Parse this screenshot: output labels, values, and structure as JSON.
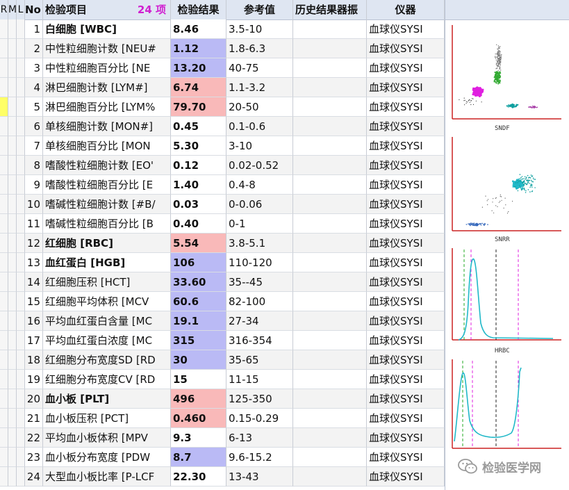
{
  "header": {
    "col_r": "R",
    "col_m": "M",
    "col_l": "L",
    "col_no": "No",
    "col_name": "检验项目",
    "item_count": "24 项",
    "col_result": "检验结果",
    "col_ref": "参考值",
    "col_history": "历史结果",
    "col_history_cut": "器振",
    "col_instrument": "仪器"
  },
  "rows": [
    {
      "no": "1",
      "name": "白细胞 [WBC]",
      "result": "8.46",
      "ref": "3.5-10",
      "instrument": "血球仪SYSI",
      "flag": "normal",
      "bold": true
    },
    {
      "no": "2",
      "name": "中性粒细胞计数 [NEU#",
      "result": "1.12",
      "ref": "1.8-6.3",
      "instrument": "血球仪SYSI",
      "flag": "low",
      "bold": false
    },
    {
      "no": "3",
      "name": "中性粒细胞百分比 [NE",
      "result": "13.20",
      "ref": "40-75",
      "instrument": "血球仪SYSI",
      "flag": "low",
      "bold": false
    },
    {
      "no": "4",
      "name": "淋巴细胞计数 [LYM#]",
      "result": "6.74",
      "ref": "1.1-3.2",
      "instrument": "血球仪SYSI",
      "flag": "high",
      "bold": false
    },
    {
      "no": "5",
      "name": "淋巴细胞百分比 [LYM%",
      "result": "79.70",
      "ref": "20-50",
      "instrument": "血球仪SYSI",
      "flag": "high",
      "bold": false,
      "marked": true
    },
    {
      "no": "6",
      "name": "单核细胞计数 [MON#]",
      "result": "0.45",
      "ref": "0.1-0.6",
      "instrument": "血球仪SYSI",
      "flag": "normal",
      "bold": false
    },
    {
      "no": "7",
      "name": "单核细胞百分比 [MON",
      "result": "5.30",
      "ref": "3-10",
      "instrument": "血球仪SYSI",
      "flag": "normal",
      "bold": false
    },
    {
      "no": "8",
      "name": "嗜酸性粒细胞计数 [EO'",
      "result": "0.12",
      "ref": "0.02-0.52",
      "instrument": "血球仪SYSI",
      "flag": "normal",
      "bold": false
    },
    {
      "no": "9",
      "name": "嗜酸性粒细胞百分比 [E",
      "result": "1.40",
      "ref": "0.4-8",
      "instrument": "血球仪SYSI",
      "flag": "normal",
      "bold": false
    },
    {
      "no": "10",
      "name": "嗜碱性粒细胞计数 [#B/",
      "result": "0.03",
      "ref": "0-0.06",
      "instrument": "血球仪SYSI",
      "flag": "normal",
      "bold": false
    },
    {
      "no": "11",
      "name": "嗜碱性粒细胞百分比 [B",
      "result": "0.40",
      "ref": "0-1",
      "instrument": "血球仪SYSI",
      "flag": "normal",
      "bold": false
    },
    {
      "no": "12",
      "name": "红细胞 [RBC]",
      "result": "5.54",
      "ref": "3.8-5.1",
      "instrument": "血球仪SYSI",
      "flag": "high",
      "bold": true
    },
    {
      "no": "13",
      "name": "血红蛋白 [HGB]",
      "result": "106",
      "ref": "110-120",
      "instrument": "血球仪SYSI",
      "flag": "low",
      "bold": true
    },
    {
      "no": "14",
      "name": "红细胞压积 [HCT]",
      "result": "33.60",
      "ref": "35--45",
      "instrument": "血球仪SYSI",
      "flag": "low",
      "bold": false
    },
    {
      "no": "15",
      "name": "红细胞平均体积 [MCV",
      "result": "60.6",
      "ref": "82-100",
      "instrument": "血球仪SYSI",
      "flag": "low",
      "bold": false
    },
    {
      "no": "16",
      "name": "平均血红蛋白含量 [MC",
      "result": "19.1",
      "ref": "27-34",
      "instrument": "血球仪SYSI",
      "flag": "low",
      "bold": false
    },
    {
      "no": "17",
      "name": "平均血红蛋白浓度 [MC",
      "result": "315",
      "ref": "316-354",
      "instrument": "血球仪SYSI",
      "flag": "low",
      "bold": false
    },
    {
      "no": "18",
      "name": "红细胞分布宽度SD [RD",
      "result": "30",
      "ref": "35-65",
      "instrument": "血球仪SYSI",
      "flag": "low",
      "bold": false
    },
    {
      "no": "19",
      "name": "红细胞分布宽度CV [RD",
      "result": "15",
      "ref": "11-15",
      "instrument": "血球仪SYSI",
      "flag": "normal",
      "bold": false
    },
    {
      "no": "20",
      "name": "血小板 [PLT]",
      "result": "496",
      "ref": "125-350",
      "instrument": "血球仪SYSI",
      "flag": "high",
      "bold": true
    },
    {
      "no": "21",
      "name": "血小板压积 [PCT]",
      "result": "0.460",
      "ref": "0.15-0.29",
      "instrument": "血球仪SYSI",
      "flag": "high",
      "bold": false
    },
    {
      "no": "22",
      "name": "平均血小板体积 [MPV",
      "result": "9.3",
      "ref": "6-13",
      "instrument": "血球仪SYSI",
      "flag": "normal",
      "bold": false
    },
    {
      "no": "23",
      "name": "血小板分布宽度 [PDW",
      "result": "8.7",
      "ref": "9.6-15.2",
      "instrument": "血球仪SYSI",
      "flag": "low",
      "bold": false
    },
    {
      "no": "24",
      "name": "大型血小板比率 [P-LCF",
      "result": "22.30",
      "ref": "13-43",
      "instrument": "血球仪SYSI",
      "flag": "normal",
      "bold": false
    }
  ],
  "graphs": {
    "sndf_label": "SNDF",
    "snrr_label": "SNRR",
    "hrbc_label": "HRBC",
    "colors": {
      "magenta": "#e020e0",
      "green": "#33aa33",
      "cyan": "#20b8c8",
      "teal": "#10a0a0",
      "axis": "#cc2222",
      "dash_green": "#22aa22",
      "dash_black": "#222222"
    }
  },
  "watermark": {
    "text": "检验医学网",
    "icon": "wechat-icon"
  },
  "colors": {
    "high": "#f9b9b9",
    "low": "#babaf5",
    "header_bg": "#dfe6f2",
    "count": "#d020d0",
    "marker": "#ffff66"
  }
}
